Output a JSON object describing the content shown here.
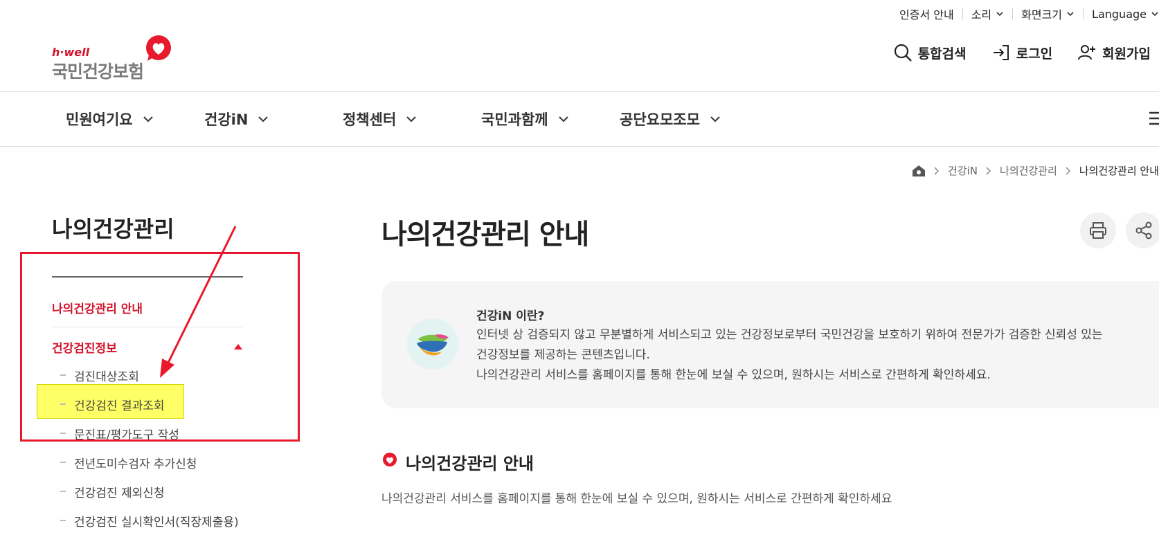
{
  "util_bar": {
    "cert": "인증서 안내",
    "sound": "소리",
    "screen_size": "화면크기",
    "language": "Language"
  },
  "logo": {
    "small": "h·well",
    "big": "국민건강보험"
  },
  "actions": {
    "search": "통합검색",
    "login": "로그인",
    "join": "회원가입"
  },
  "gnb": [
    "민원여기요",
    "건강iN",
    "정책센터",
    "국민과함께",
    "공단요모조모"
  ],
  "breadcrumb": [
    "건강iN",
    "나의건강관리",
    "나의건강관리 안내"
  ],
  "side": {
    "title": "나의건강관리",
    "menu": [
      {
        "label": "나의건강관리 안내"
      },
      {
        "label": "건강검진정보"
      }
    ],
    "submenu": [
      "검진대상조회",
      "건강검진 결과조회",
      "문진표/평가도구 작성",
      "전년도미수검자 추가신청",
      "건강검진 제외신청",
      "건강검진 실시확인서(직장제출용)"
    ]
  },
  "main": {
    "title": "나의건강관리 안내",
    "info_title": "건강iN 이란?",
    "info_lines": [
      "인터넷 상 검증되지 않고 무분별하게 서비스되고 있는 건강정보로부터 국민건강을 보호하기 위하여 전문가가 검증한 신뢰성 있는",
      "건강정보를 제공하는 콘텐츠입니다.",
      "나의건강관리 서비스를 홈페이지를 통해 한눈에 보실 수 있으며, 원하시는 서비스로 간편하게 확인하세요."
    ],
    "section_title": "나의건강관리 안내",
    "section_desc": "나의건강관리 서비스를 홈페이지를 통해 한눈에 보실 수 있으며, 원하시는 서비스로 간편하게 확인하세요"
  },
  "colors": {
    "accent": "#d3122a",
    "annotation_red": "#e8192c",
    "highlight": "#ffff66"
  }
}
